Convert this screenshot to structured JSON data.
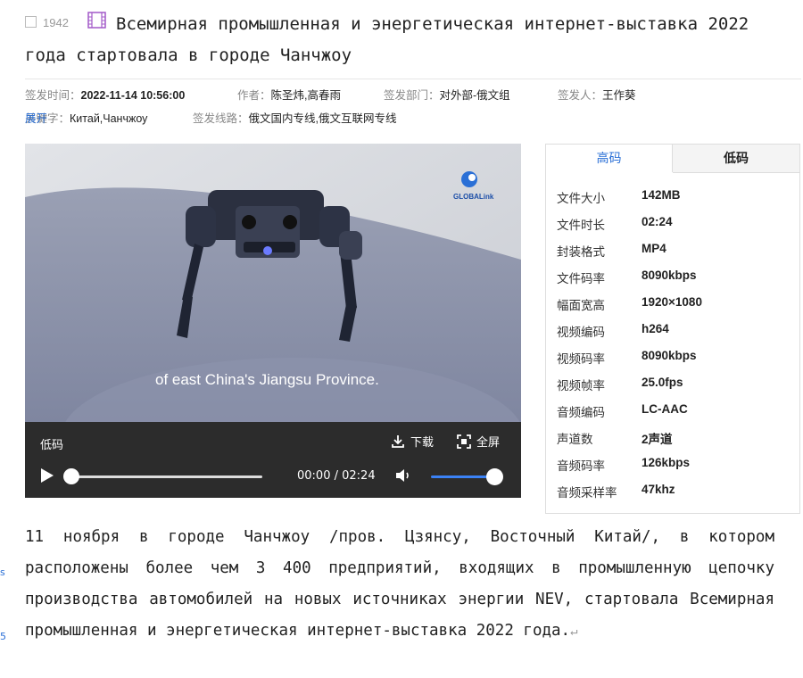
{
  "header": {
    "id_number": "1942",
    "title": "Всемирная промышленная и энергетическая интернет-выставка 2022 года стартовала в городе Чанчжоу"
  },
  "meta": {
    "date_label": "签发时间：",
    "date_value": "2022-11-14 10:56:00",
    "author_label": "作者：",
    "author_value": "陈圣炜,高春雨",
    "dept_label": "签发部门：",
    "dept_value": "对外部-俄文组",
    "issuer_label": "签发人：",
    "issuer_value": "王作葵",
    "keywords_label": "关键字：",
    "keywords_value": "Китай,Чанчжоу",
    "lines_label": "签发线路：",
    "lines_value": "俄文国内专线,俄文互联网专线",
    "expand_label": "展开"
  },
  "video": {
    "caption": "of east China's Jiangsu Province.",
    "logo_text": "GLOBALink",
    "quality_label": "低码",
    "download_label": "下载",
    "fullscreen_label": "全屏",
    "current_time": "00:00",
    "duration": "02:24",
    "progress_fraction": 0.0,
    "volume_fraction": 1.0
  },
  "panel": {
    "tab_high": "高码",
    "tab_low": "低码",
    "specs": [
      {
        "k": "文件大小",
        "v": "142MB"
      },
      {
        "k": "文件时长",
        "v": "02:24"
      },
      {
        "k": "封装格式",
        "v": "MP4"
      },
      {
        "k": "文件码率",
        "v": "8090kbps"
      },
      {
        "k": "幅面宽高",
        "v": "1920×1080"
      },
      {
        "k": "视频编码",
        "v": "h264"
      },
      {
        "k": "视频码率",
        "v": "8090kbps"
      },
      {
        "k": "视频帧率",
        "v": "25.0fps"
      },
      {
        "k": "音频编码",
        "v": "LC-AAC"
      },
      {
        "k": "声道数",
        "v": "2声道"
      },
      {
        "k": "音频码率",
        "v": "126kbps"
      },
      {
        "k": "音频采样率",
        "v": "47khz"
      }
    ]
  },
  "body_text": "11 ноября в городе Чанчжоу /пров. Цзянсу, Восточный Китай/, в котором расположены более чем 3 400 предприятий, входящих в промышленную цепочку производства автомобилей на новых источниках энергии NEV, стартовала Всемирная промышленная и энергетическая интернет-выставка 2022 года.",
  "colors": {
    "accent": "#2a6fd6",
    "film_icon": "#a259c8",
    "player_bar": "#2c2c2c",
    "volume": "#3b82f6"
  }
}
